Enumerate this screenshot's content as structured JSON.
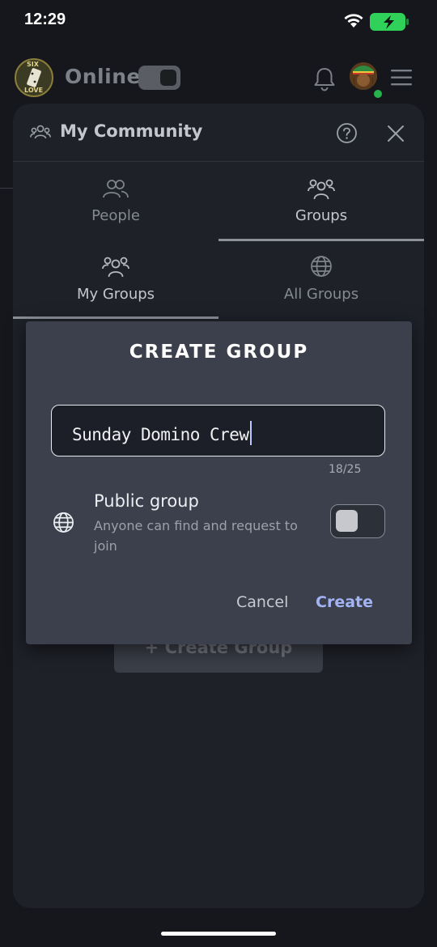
{
  "status_bar": {
    "time": "12:29"
  },
  "header": {
    "logo_text_top": "SIX",
    "logo_text_bottom": "LOVE",
    "online_label": "Online"
  },
  "panel": {
    "title": "My Community",
    "main_tabs": [
      {
        "label": "People"
      },
      {
        "label": "Groups"
      }
    ],
    "sub_tabs": [
      {
        "label": "My Groups"
      },
      {
        "label": "All Groups"
      }
    ],
    "background_button_label": "+ Create Group"
  },
  "dialog": {
    "title": "CREATE GROUP",
    "name_value": "Sunday Domino Crew",
    "counter": "18/25",
    "public_title": "Public group",
    "public_description": "Anyone can find and request to join",
    "public_enabled": false,
    "cancel_label": "Cancel",
    "create_label": "Create"
  },
  "colors": {
    "background": "#15171c",
    "panel": "#1e2128",
    "dialog": "#3c404c",
    "accent": "#a3b4f4"
  }
}
